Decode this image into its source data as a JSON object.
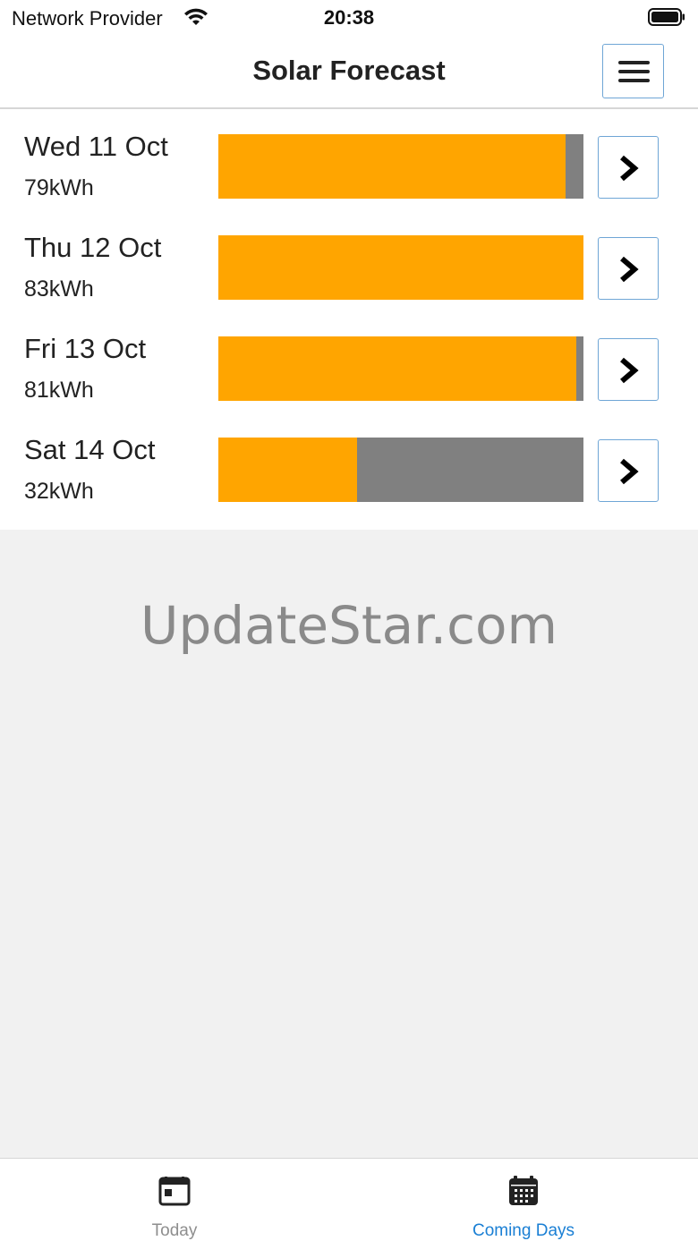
{
  "status_bar": {
    "carrier": "Network Provider",
    "time": "20:38"
  },
  "header": {
    "title": "Solar Forecast"
  },
  "colors": {
    "forecast_fill": "#ffa500",
    "bar_track": "#808080",
    "accent": "#1a7fd4",
    "button_border": "#6fa6d6"
  },
  "days": [
    {
      "label": "Wed 11 Oct",
      "energy": "79kWh",
      "fill_fraction": 0.952
    },
    {
      "label": "Thu 12 Oct",
      "energy": "83kWh",
      "fill_fraction": 1.0
    },
    {
      "label": "Fri 13 Oct",
      "energy": "81kWh",
      "fill_fraction": 0.981
    },
    {
      "label": "Sat 14 Oct",
      "energy": "32kWh",
      "fill_fraction": 0.381
    }
  ],
  "watermark": "UpdateStar.com",
  "tabs": [
    {
      "label": "Today",
      "icon": "calendar-today-icon",
      "active": false
    },
    {
      "label": "Coming Days",
      "icon": "calendar-grid-icon",
      "active": true
    }
  ]
}
